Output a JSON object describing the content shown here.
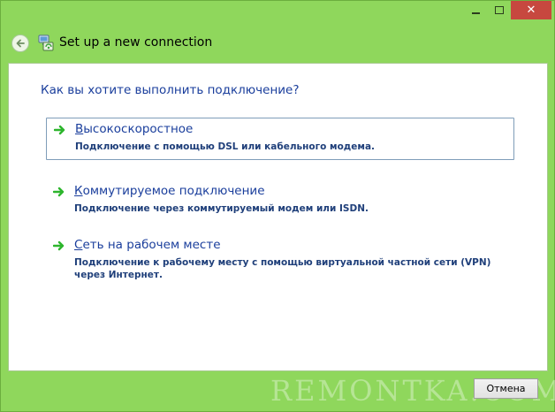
{
  "window": {
    "title": "Set up a new connection",
    "controls": {
      "minimize": "minimize",
      "maximize": "maximize",
      "close": "✕"
    }
  },
  "main": {
    "heading": "Как вы хотите выполнить подключение?",
    "options": [
      {
        "hotkey": "В",
        "title_rest": "ысокоскоростное",
        "description": "Подключение с помощью DSL или кабельного модема.",
        "selected": true
      },
      {
        "hotkey": "К",
        "title_rest": "оммутируемое подключение",
        "description": "Подключение через коммутируемый модем или ISDN.",
        "selected": false
      },
      {
        "hotkey": "С",
        "title_rest": "еть на рабочем месте",
        "description": "Подключение к рабочему месту с помощью виртуальной частной сети (VPN) через Интернет.",
        "selected": false
      }
    ]
  },
  "footer": {
    "cancel_label": "Отмена",
    "watermark": "REMONTKA.COM"
  },
  "colors": {
    "frame": "#8fd75c",
    "close_button": "#c7483f",
    "link_blue": "#1a3e9c",
    "arrow_green": "#2db52d"
  },
  "icons": {
    "back": "back-arrow-icon",
    "app": "network-connection-icon",
    "option_arrow": "green-arrow-icon"
  }
}
